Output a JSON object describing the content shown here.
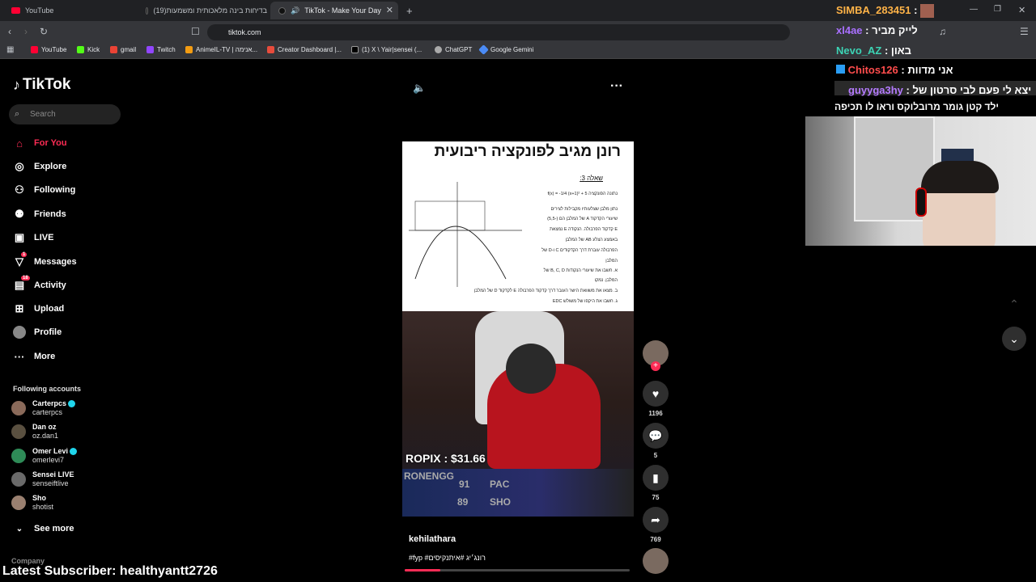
{
  "browser": {
    "tabs": [
      {
        "title": "YouTube"
      },
      {
        "title": "(19)בדיחות בינה מלאכותית ומשמעות"
      },
      {
        "title": "TikTok - Make Your Day"
      }
    ],
    "url": "tiktok.com",
    "bookmarks": [
      "YouTube",
      "Kick",
      "gmail",
      "Twitch",
      "AnimeIL-TV | אנימה...",
      "Creator Dashboard |...",
      "(1) X \\ Yair|sensei (...",
      "ChatGPT",
      "Google Gemini"
    ]
  },
  "sidebar": {
    "logo": "TikTok",
    "search_placeholder": "Search",
    "items": [
      {
        "label": "For You",
        "icon": "home-icon"
      },
      {
        "label": "Explore",
        "icon": "compass-icon"
      },
      {
        "label": "Following",
        "icon": "following-icon"
      },
      {
        "label": "Friends",
        "icon": "friends-icon"
      },
      {
        "label": "LIVE",
        "icon": "live-icon"
      },
      {
        "label": "Messages",
        "icon": "messages-icon",
        "badge": "1"
      },
      {
        "label": "Activity",
        "icon": "activity-icon",
        "badge": "18"
      },
      {
        "label": "Upload",
        "icon": "upload-icon"
      },
      {
        "label": "Profile",
        "icon": "profile-icon"
      },
      {
        "label": "More",
        "icon": "more-icon"
      }
    ],
    "following_header": "Following accounts",
    "accounts": [
      {
        "name": "Carterpcs",
        "handle": "carterpcs"
      },
      {
        "name": "Dan oz",
        "handle": "oz.dan1"
      },
      {
        "name": "Omer Levi",
        "handle": "omerlevi7"
      },
      {
        "name": "Sensei LIVE",
        "handle": "senseiftlive"
      },
      {
        "name": "Sho",
        "handle": "shotist"
      }
    ],
    "see_more": "See more",
    "company": "Company"
  },
  "video": {
    "doc_title": "רונן מגיב לפונקציה ריבועית",
    "doc_question": "שאלה 3:",
    "doc_lines": [
      "נתונה הפונקציה  f(x) = -1/4 (x+1)² + 5",
      "נתון מלבן שצלעותיו מקבילות לצירים",
      "שיעורי הקדקוד A של המלבן הם (-5,5)",
      "E קדקוד הפרבולה. הנקודה E נמצאת",
      "באמצע הצלע AB של המלבן",
      "הפרבולה עוברת דרך הקדקודים C ו-D של",
      "המלבן",
      "א. חשבו את שיעורי הנקודות B, C, D של",
      "המלבן. נמקו",
      "ב. מצאו את משוואת הישר העובר דרך קדקוד הפרבולה E לקדקוד D של המלבן",
      "ג. חשבו את היקפו של משולש EDC"
    ],
    "overlay_text": "ROPIX : $31.66",
    "scoreboard": [
      "RONENGG",
      "91",
      "PAC",
      "89",
      "SHO"
    ],
    "author": "kehilathara",
    "caption": "#fyp #רונג׳יג #איתנקיסים",
    "progress": 0.16
  },
  "actions": {
    "likes": "1196",
    "comments": "5",
    "saves": "75",
    "shares": "769"
  },
  "stream_overlay": {
    "chat": [
      {
        "user": "SIMBA_283451",
        "text": "",
        "color": "#ffb347"
      },
      {
        "user": "xl4ae",
        "text": "לייק מביר",
        "color": "#a970ff"
      },
      {
        "user": "Nevo_AZ",
        "text": "באון",
        "color": "#3cd3b4"
      },
      {
        "user": "Chitos126",
        "text": "אני מדוות",
        "color": "#ff4d4d"
      },
      {
        "user": "guyyga3hy",
        "text": "יצא לי פעם לבי סרטון של",
        "color": "#b57bff"
      }
    ],
    "chat_extra": "ילד קטן גומר מרובלוקס וראו לו תכיפה",
    "latest_subscriber": "Latest Subscriber: healthyantt2726"
  }
}
